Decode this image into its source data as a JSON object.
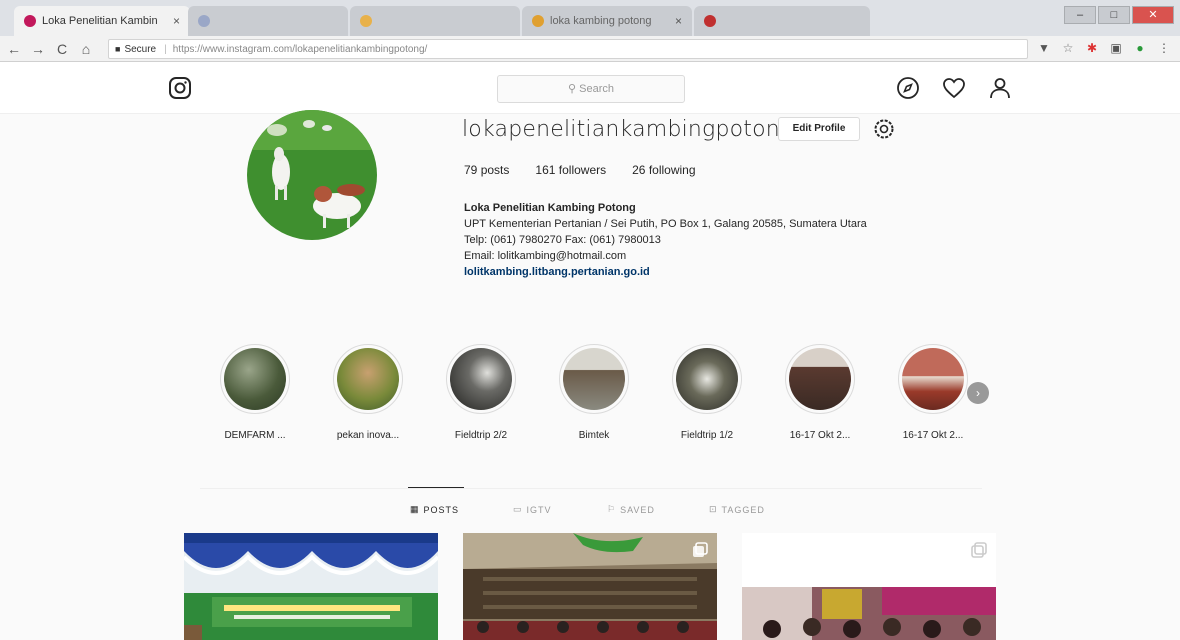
{
  "browser": {
    "tabs": [
      {
        "title": "Loka Penelitian Kambin",
        "close": "×",
        "favicon_color": "#c2185b"
      },
      {
        "title": "",
        "close": "",
        "favicon_color": "#9aa7c7"
      },
      {
        "title": "",
        "close": "",
        "favicon_color": "#e8b14a"
      },
      {
        "title": "loka kambing potong",
        "close": "×",
        "favicon_color": "#e0a030"
      },
      {
        "title": "",
        "close": "",
        "favicon_color": "#c03030"
      }
    ],
    "window_controls": {
      "minimize": "–",
      "maximize": "□",
      "close": "✕"
    },
    "toolbar": {
      "back": "←",
      "forward": "→",
      "reload": "C",
      "home": "⌂",
      "secure_label": "Secure",
      "url": "https://www.instagram.com/lokapenelitiankambingpotong/"
    }
  },
  "ig": {
    "search_placeholder": "Search",
    "icons": [
      "instagram-logo-icon",
      "compass-icon",
      "heart-icon",
      "person-icon"
    ]
  },
  "profile": {
    "username": "lokapenelitiankambingpotong",
    "edit_label": "Edit Profile",
    "stats": {
      "posts_num": "79",
      "posts_label": "posts",
      "followers_num": "161",
      "followers_label": "followers",
      "following_num": "26",
      "following_label": "following"
    },
    "bio": {
      "name": "Loka Penelitian Kambing Potong",
      "line1": "UPT Kementerian Pertanian / Sei Putih, PO Box 1, Galang 20585, Sumatera Utara",
      "line2": "Telp: (061) 7980270 Fax: (061) 7980013",
      "line3": "Email: lolitkambing@hotmail.com",
      "link": "lolitkambing.litbang.pertanian.go.id"
    }
  },
  "highlights": [
    {
      "label": "DEMFARM ...",
      "color": "#4a5a3a"
    },
    {
      "label": "pekan inova...",
      "color": "#7a8a3a"
    },
    {
      "label": "Fieldtrip 2/2",
      "color": "#2a2a2a"
    },
    {
      "label": "Bimtek",
      "color": "#8a8a80"
    },
    {
      "label": "Fieldtrip 1/2",
      "color": "#3a3a35"
    },
    {
      "label": "16-17 Okt 2...",
      "color": "#5a3a30"
    },
    {
      "label": "16-17 Okt 2...",
      "color": "#9a3a2a"
    }
  ],
  "highlights_next": "›",
  "post_tabs": [
    {
      "label": "POSTS",
      "icon": "▦"
    },
    {
      "label": "IGTV",
      "icon": "▭"
    },
    {
      "label": "SAVED",
      "icon": "⚐"
    },
    {
      "label": "TAGGED",
      "icon": "⊡"
    }
  ]
}
